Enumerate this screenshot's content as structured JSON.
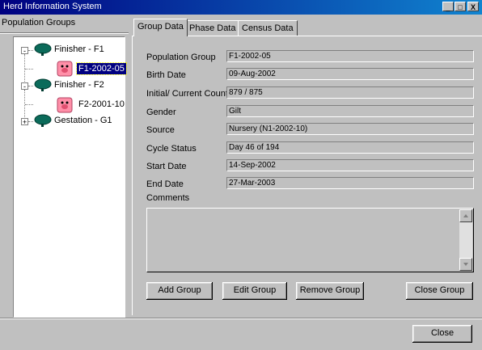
{
  "window": {
    "title": "Herd Information System",
    "controls": [
      "_",
      "□",
      "X"
    ]
  },
  "left_header": "Population Groups",
  "tree": [
    {
      "label": "Finisher - F1",
      "type": "group",
      "expanded": "-"
    },
    {
      "label": "F1-2002-05",
      "type": "pig",
      "selected": true
    },
    {
      "label": "Finisher - F2",
      "type": "group",
      "expanded": "-"
    },
    {
      "label": "F2-2001-10",
      "type": "pig"
    },
    {
      "label": "Gestation - G1",
      "type": "group",
      "expanded": "+"
    }
  ],
  "tabs": [
    "Group Data",
    "Phase Data",
    "Census Data"
  ],
  "fields": [
    {
      "label": "Population Group",
      "value": "F1-2002-05"
    },
    {
      "label": "Birth Date",
      "value": "09-Aug-2002"
    },
    {
      "label": "Initial/ Current Count",
      "value": "879 / 875"
    },
    {
      "label": "Gender",
      "value": "Gilt"
    },
    {
      "label": "Source",
      "value": "Nursery (N1-2002-10)"
    },
    {
      "label": "Cycle Status",
      "value": "Day 46 of 194"
    },
    {
      "label": "Start Date",
      "value": "14-Sep-2002"
    },
    {
      "label": "End Date",
      "value": "27-Mar-2003"
    }
  ],
  "comments_label": "Comments",
  "comments_value": "",
  "buttons": {
    "add": "Add Group",
    "edit": "Edit Group",
    "remove": "Remove Group",
    "close_group": "Close Group",
    "close": "Close"
  },
  "colors": {
    "title_start": "#000080",
    "title_end": "#1084d0",
    "face": "#c0c0c0",
    "tree_icon": "#0b6b5a",
    "pig_icon": "#ff8fa8"
  }
}
